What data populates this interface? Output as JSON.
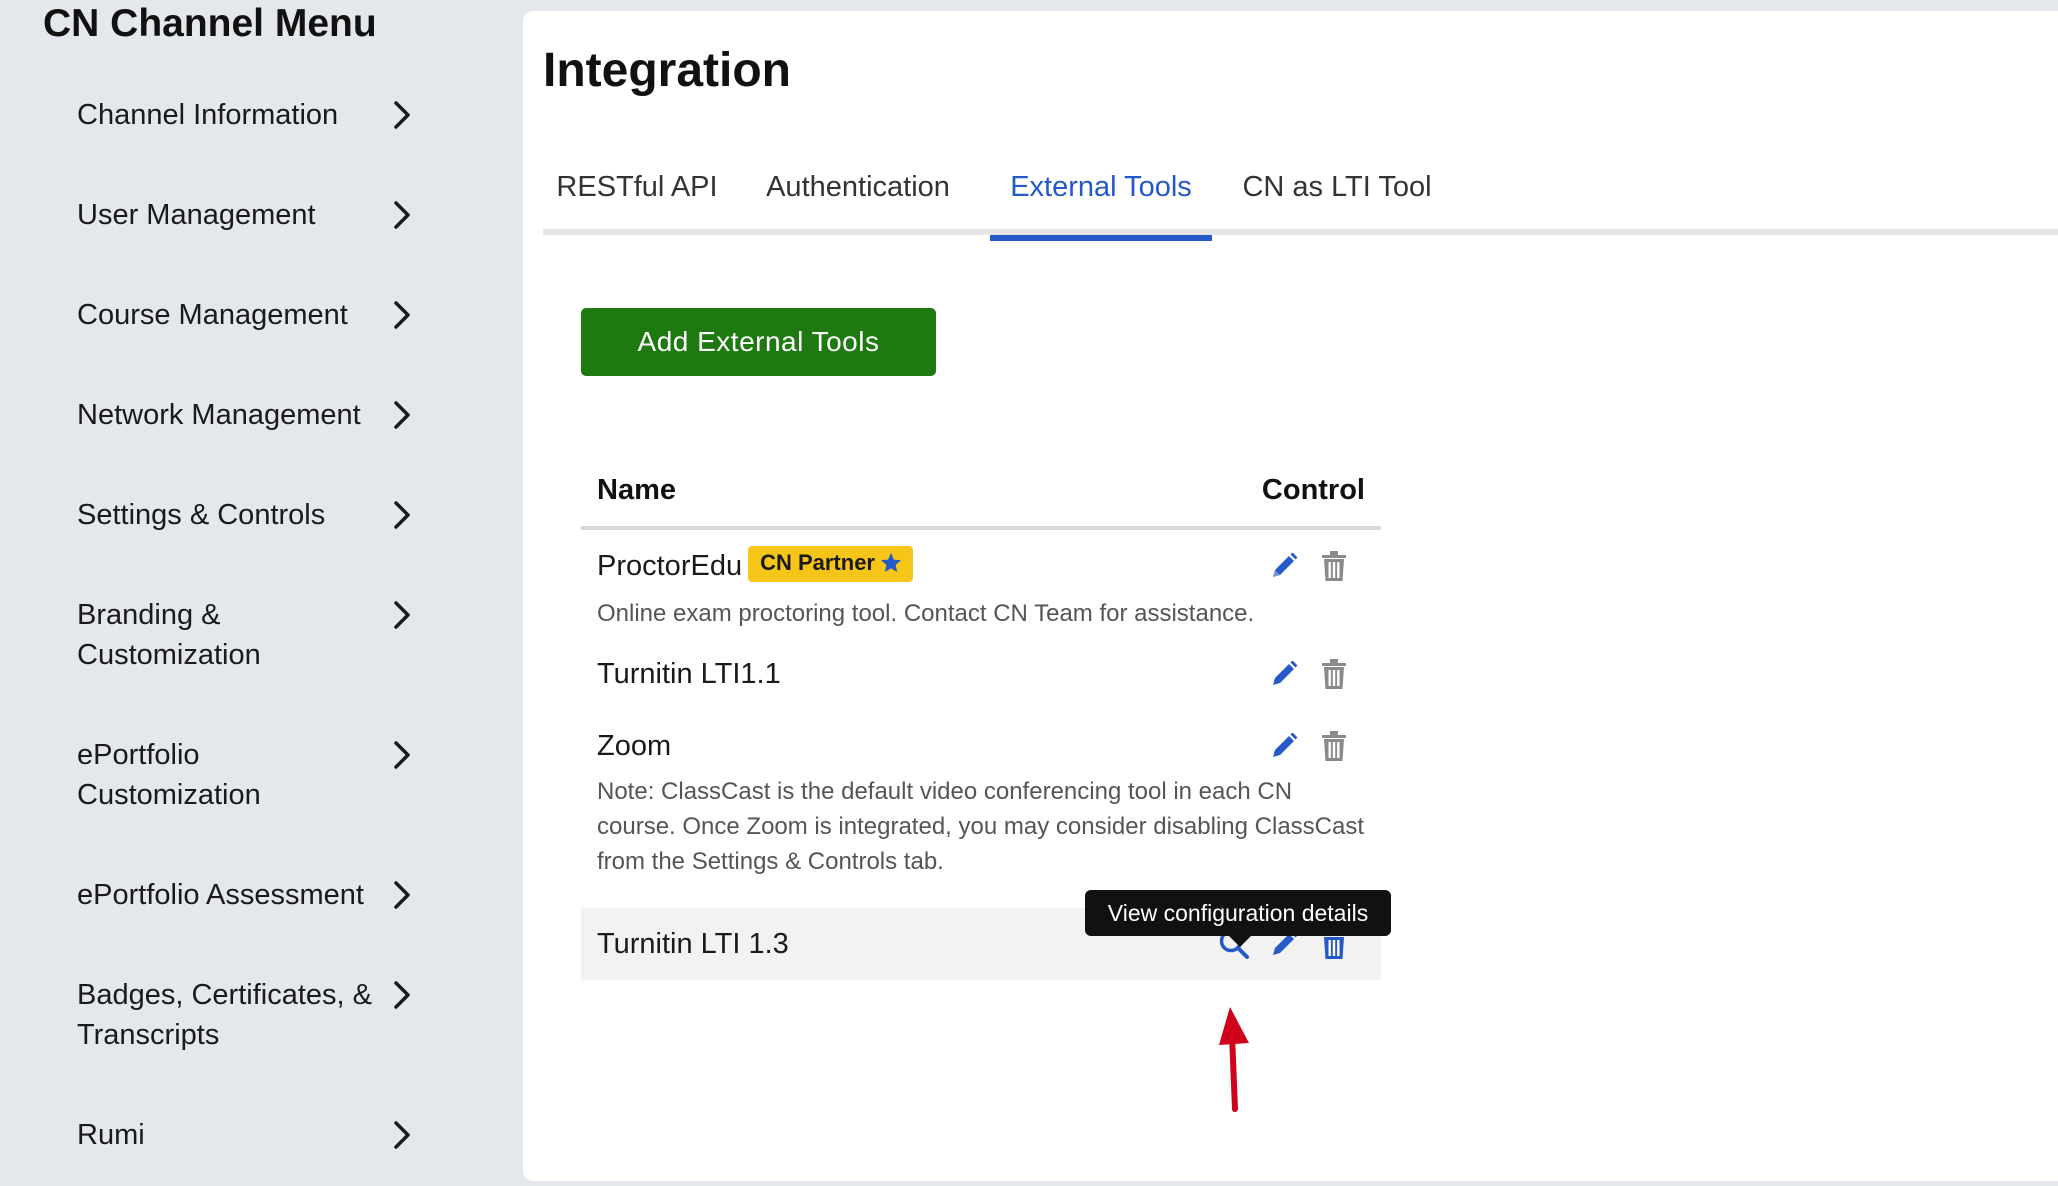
{
  "sidebar": {
    "title": "CN Channel Menu",
    "items": [
      {
        "label": "Channel Information"
      },
      {
        "label": "User Management"
      },
      {
        "label": "Course Management"
      },
      {
        "label": "Network Management"
      },
      {
        "label": "Settings & Controls"
      },
      {
        "label": "Branding & Customization"
      },
      {
        "label": "ePortfolio Customization"
      },
      {
        "label": "ePortfolio Assessment"
      },
      {
        "label": "Badges, Certificates, & Transcripts"
      },
      {
        "label": "Rumi"
      }
    ]
  },
  "main": {
    "title": "Integration",
    "tabs": [
      {
        "label": "RESTful API"
      },
      {
        "label": "Authentication"
      },
      {
        "label": "External Tools",
        "active": true
      },
      {
        "label": "CN as LTI Tool"
      }
    ],
    "add_button": "Add External Tools",
    "table": {
      "col_name": "Name",
      "col_control": "Control",
      "rows": [
        {
          "name": "ProctorEdu",
          "badge": "CN Partner",
          "desc": "Online exam proctoring tool. Contact CN Team for assistance."
        },
        {
          "name": "Turnitin LTI1.1"
        },
        {
          "name": "Zoom",
          "desc": "Note: ClassCast is the default video conferencing tool in each CN course. Once Zoom is integrated, you may consider disabling ClassCast from the Settings & Controls tab."
        },
        {
          "name": "Turnitin LTI 1.3"
        }
      ]
    },
    "tooltip": "View configuration details"
  },
  "colors": {
    "accent_blue": "#2459c7",
    "add_button_green": "#1e7a10",
    "badge_yellow": "#f5c518",
    "annotation_red": "#d0021b"
  },
  "icons": {
    "edit": "pencil-icon",
    "delete": "trash-icon",
    "view": "search-icon",
    "badge": "star-icon",
    "menu_expand": "chevron-right-icon"
  }
}
